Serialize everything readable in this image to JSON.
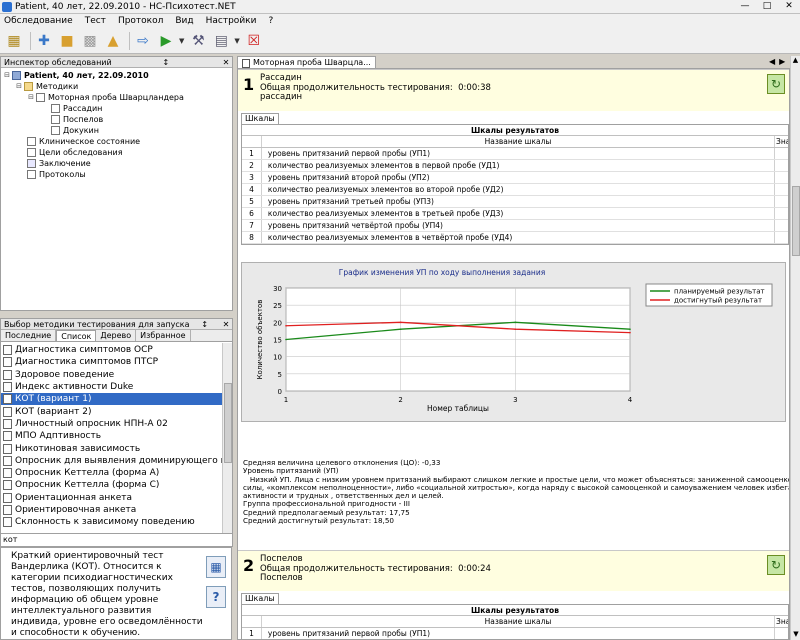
{
  "window": {
    "title": "Patient, 40 лет, 22.09.2010 - НС-Психотест.NET"
  },
  "menu": [
    "Обследование",
    "Тест",
    "Протокол",
    "Вид",
    "Настройки",
    "?"
  ],
  "inspector": {
    "title": "Инспектор обследований",
    "tree": {
      "patient": "Patient, 40 лет, 22.09.2010",
      "methods": "Методики",
      "test": "Моторная проба Шварцландера",
      "subtests": [
        "Рассадин",
        "Поспелов",
        "Докукин"
      ],
      "other": [
        "Клиническое состояние",
        "Цели обследования",
        "Заключение",
        "Протоколы"
      ]
    }
  },
  "selector": {
    "title": "Выбор методики тестирования для запуска",
    "tabs": [
      "Последние",
      "Список",
      "Дерево",
      "Избранное"
    ],
    "active_tab": "Список",
    "items": [
      "Диагностика симптомов ОСР",
      "Диагностика симптомов ПТСР",
      "Здоровое поведение",
      "Индекс активности Duke",
      "КОТ (вариант 1)",
      "КОТ (вариант 2)",
      "Личностный опросник НПН-А 02",
      "МПО Адптивность",
      "Никотиновая зависимость",
      "Опросник для выявления доминирующего инст...",
      "Опросник Кеттелла (форма А)",
      "Опросник Кеттелла (форма С)",
      "Ориентационная анкета",
      "Ориентировочная анкета",
      "Склонность к зависимому поведению"
    ],
    "selected_index": 4,
    "search_value": "кот",
    "description": "Краткий ориентировочный тест Вандерлика (КОТ). Относится к категории психодиагностических тестов, позволяющих получить информацию об общем уровне интеллектуального развития индивида, уровне его осведомлённости и способности к обучению."
  },
  "doc": {
    "tab": "Моторная проба Шварцла...",
    "sections": [
      {
        "num": "1",
        "name": "Рассадин",
        "duration_label": "Общая продолжительность тестирования:",
        "duration": "0:00:38",
        "name2": "рассадин"
      },
      {
        "num": "2",
        "name": "Поспелов",
        "duration_label": "Общая продолжительность тестирования:",
        "duration": "0:00:24",
        "name2": "Поспелов"
      }
    ],
    "scales_tab": "Шкалы",
    "table_title": "Шкалы результатов",
    "col_name": "Название шкалы",
    "col_value": "Зна",
    "rows": [
      {
        "n": "1",
        "name": "уровень притязаний первой пробы (УП1)"
      },
      {
        "n": "2",
        "name": "количество реализуемых элементов в первой пробе (УД1)"
      },
      {
        "n": "3",
        "name": "уровень притязаний второй пробы (УП2)"
      },
      {
        "n": "4",
        "name": "количество реализуемых элементов во второй пробе (УД2)"
      },
      {
        "n": "5",
        "name": "уровень притязаний третьей пробы (УП3)"
      },
      {
        "n": "6",
        "name": "количество реализуемых элементов в третьей пробе (УД3)"
      },
      {
        "n": "7",
        "name": "уровень притязаний четвёртой пробы (УП4)"
      },
      {
        "n": "8",
        "name": "количество реализуемых элементов в четвёртой пробе (УД4)"
      }
    ],
    "row2_first": {
      "n": "1",
      "name": "уровень притязаний первой пробы (УП1)"
    },
    "narrative": [
      "Средняя величина целевого отклонения (ЦО): -0,33",
      "Уровень притязаний (УП)",
      "   Низкий УП. Лица с низким уровнем притязаний выбирают слишком легкие и простые цели, что может объясняться: заниженной самооценкой, неверием в свои",
      "силы, «комплексом неполноценности», либо «социальной хитростью», когда наряду с высокой самооценкой и самоуважением человек избегает социальной",
      "активности и трудных , ответственных дел и целей.",
      "Группа профессиональной пригодности - III",
      "Средний предполагаемый результат: 17,75",
      "Средний достигнутый результат: 18,50"
    ]
  },
  "chart_data": {
    "type": "line",
    "title": "График изменения УП по ходу выполнения задания",
    "xlabel": "Номер таблицы",
    "ylabel": "Количество объектов",
    "x": [
      1,
      2,
      3,
      4
    ],
    "ylim": [
      0,
      30
    ],
    "yticks": [
      0,
      5,
      10,
      15,
      20,
      25,
      30
    ],
    "grid": true,
    "legend_position": "top-right",
    "series": [
      {
        "name": "планируемый результат",
        "color": "#1a8a1a",
        "values": [
          15,
          18,
          20,
          18
        ]
      },
      {
        "name": "достигнутый результат",
        "color": "#e02020",
        "values": [
          19,
          20,
          18,
          17
        ]
      }
    ]
  }
}
